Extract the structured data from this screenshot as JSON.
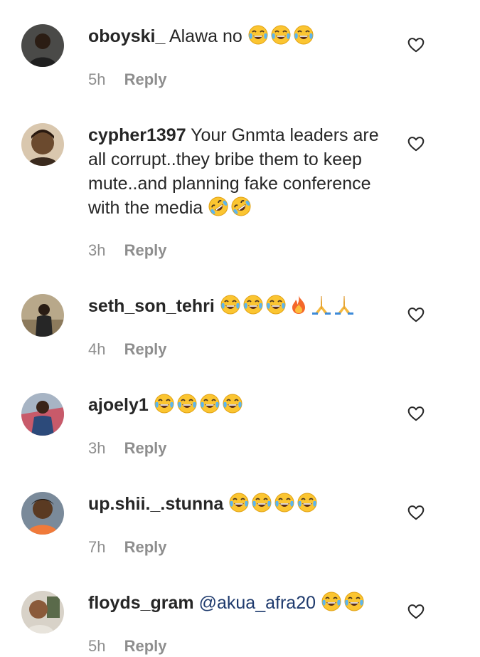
{
  "comments": [
    {
      "username": "oboyski_",
      "text": "Alawa no",
      "mention": "",
      "emojis": [
        "face-with-tears-of-joy",
        "face-with-tears-of-joy",
        "face-with-tears-of-joy"
      ],
      "time": "5h",
      "reply_label": "Reply",
      "avatar_color": "#3d3a36"
    },
    {
      "username": "cypher1397",
      "text": "Your Gnmta leaders are all corrupt..they bribe them to keep mute..and planning fake conference with the media",
      "mention": "",
      "emojis": [
        "rolling-on-floor-laughing",
        "rolling-on-floor-laughing"
      ],
      "time": "3h",
      "reply_label": "Reply",
      "avatar_color": "#6b4a2e"
    },
    {
      "username": "seth_son_tehri",
      "text": "",
      "mention": "",
      "emojis": [
        "face-with-tears-of-joy",
        "face-with-tears-of-joy",
        "face-with-tears-of-joy",
        "fire",
        "folded-hands",
        "folded-hands"
      ],
      "time": "4h",
      "reply_label": "Reply",
      "avatar_color": "#8a7a5e"
    },
    {
      "username": "ajoely1",
      "text": "",
      "mention": "",
      "emojis": [
        "face-with-tears-of-joy",
        "face-with-tears-of-joy",
        "face-with-tears-of-joy",
        "face-with-tears-of-joy"
      ],
      "time": "3h",
      "reply_label": "Reply",
      "avatar_color": "#9b6b7a"
    },
    {
      "username": "up.shii._.stunna",
      "text": "",
      "mention": "",
      "emojis": [
        "face-with-tears-of-joy",
        "face-with-tears-of-joy",
        "face-with-tears-of-joy",
        "face-with-tears-of-joy"
      ],
      "time": "7h",
      "reply_label": "Reply",
      "avatar_color": "#e06a3a"
    },
    {
      "username": "floyds_gram",
      "text": "",
      "mention": "@akua_afra20",
      "emojis": [
        "face-with-tears-of-joy",
        "face-with-tears-of-joy"
      ],
      "time": "5h",
      "reply_label": "Reply",
      "avatar_color": "#b8a99a"
    }
  ],
  "colors": {
    "text": "#262626",
    "secondary_text": "#8e8e8e",
    "mention": "#1e3a6d",
    "background": "#ffffff"
  }
}
